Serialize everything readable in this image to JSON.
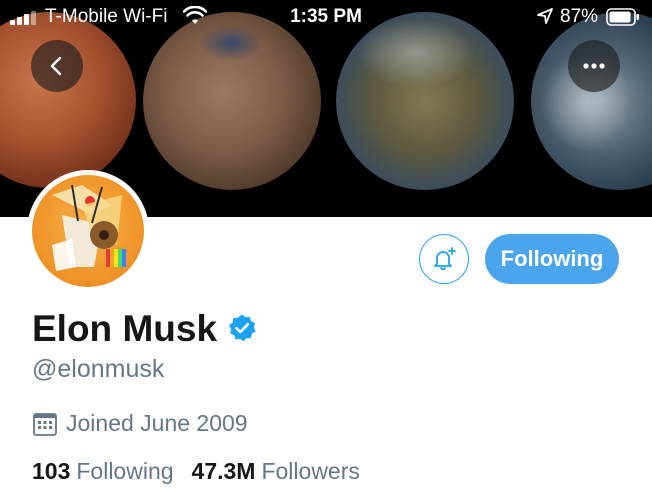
{
  "status_bar": {
    "carrier": "T-Mobile Wi-Fi",
    "time": "1:35 PM",
    "battery_percent": "87%"
  },
  "header": {
    "back_icon": "chevron-left-icon",
    "more_icon": "more-horizontal-icon"
  },
  "profile": {
    "name": "Elon Musk",
    "handle": "@elonmusk",
    "verified": true,
    "joined": "Joined June 2009",
    "following_count": "103",
    "following_label": "Following",
    "followers_count": "47.3M",
    "followers_label": "Followers"
  },
  "actions": {
    "notify_icon": "bell-plus-icon",
    "follow_button_label": "Following"
  },
  "colors": {
    "accent": "#1da1f2",
    "following_button": "#4aa5ec",
    "secondary_text": "#657786",
    "primary_text": "#14171a"
  }
}
